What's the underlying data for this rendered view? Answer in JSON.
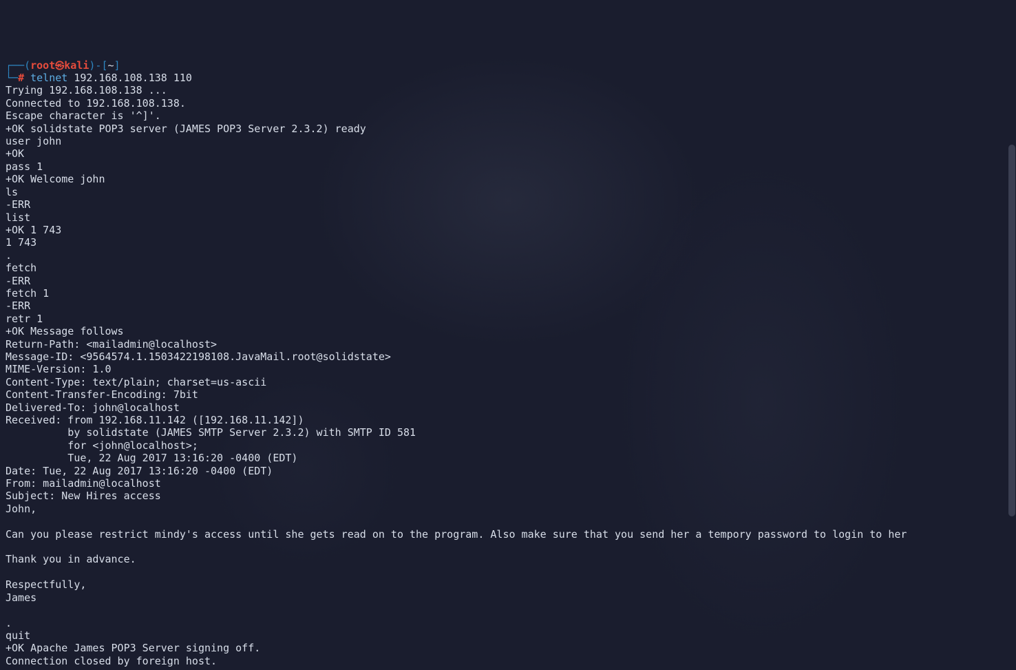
{
  "prompt": {
    "box_tl": "┌──",
    "paren_open": "(",
    "user": "root",
    "skull": "㉿",
    "host": "kali",
    "paren_close": ")",
    "dash": "-",
    "bracket_open": "[",
    "cwd": "~",
    "bracket_close": "]",
    "box_bl": "└─",
    "hash": "#",
    "cmd": "telnet",
    "args": "192.168.108.138 110"
  },
  "out": {
    "l1": "Trying 192.168.108.138 ...",
    "l2": "Connected to 192.168.108.138.",
    "l3": "Escape character is '^]'.",
    "l4": "+OK solidstate POP3 server (JAMES POP3 Server 2.3.2) ready",
    "l5": "user john",
    "l6": "+OK",
    "l7": "pass 1",
    "l8": "+OK Welcome john",
    "l9": "ls",
    "l10": "-ERR",
    "l11": "list",
    "l12": "+OK 1 743",
    "l13": "1 743",
    "l14": ".",
    "l15": "fetch",
    "l16": "-ERR",
    "l17": "fetch 1",
    "l18": "-ERR",
    "l19": "retr 1",
    "l20": "+OK Message follows",
    "l21": "Return-Path: <mailadmin@localhost>",
    "l22": "Message-ID: <9564574.1.1503422198108.JavaMail.root@solidstate>",
    "l23": "MIME-Version: 1.0",
    "l24": "Content-Type: text/plain; charset=us-ascii",
    "l25": "Content-Transfer-Encoding: 7bit",
    "l26": "Delivered-To: john@localhost",
    "l27": "Received: from 192.168.11.142 ([192.168.11.142])",
    "l28": "          by solidstate (JAMES SMTP Server 2.3.2) with SMTP ID 581",
    "l29": "          for <john@localhost>;",
    "l30": "          Tue, 22 Aug 2017 13:16:20 -0400 (EDT)",
    "l31": "Date: Tue, 22 Aug 2017 13:16:20 -0400 (EDT)",
    "l32": "From: mailadmin@localhost",
    "l33": "Subject: New Hires access",
    "l34": "John,",
    "l35": "",
    "l36": "Can you please restrict mindy's access until she gets read on to the program. Also make sure that you send her a tempory password to login to her",
    "l37": "",
    "l38": "Thank you in advance.",
    "l39": "",
    "l40": "Respectfully,",
    "l41": "James",
    "l42": "",
    "l43": ".",
    "l44": "quit",
    "l45": "+OK Apache James POP3 Server signing off.",
    "l46": "Connection closed by foreign host."
  }
}
